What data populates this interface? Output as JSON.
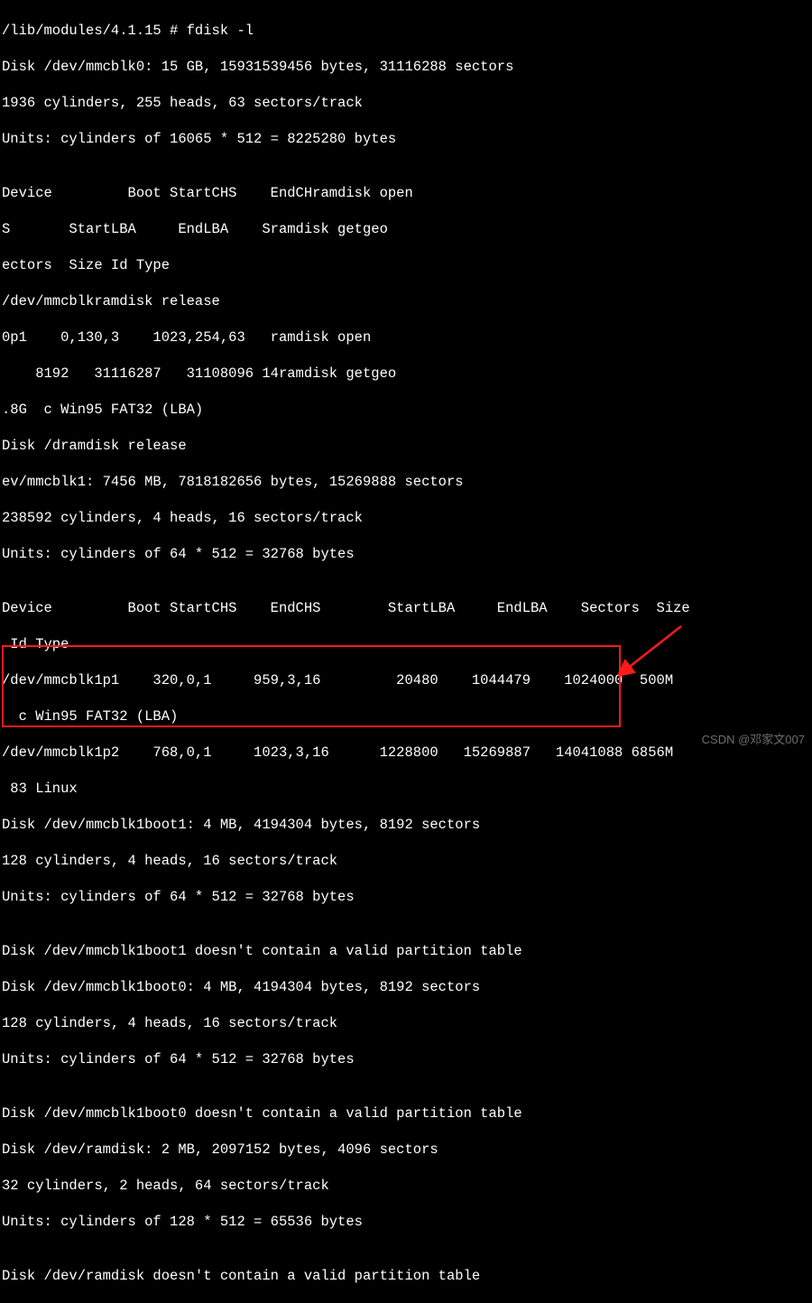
{
  "lines": [
    "/lib/modules/4.1.15 # fdisk -l",
    "Disk /dev/mmcblk0: 15 GB, 15931539456 bytes, 31116288 sectors",
    "1936 cylinders, 255 heads, 63 sectors/track",
    "Units: cylinders of 16065 * 512 = 8225280 bytes",
    "",
    "Device         Boot StartCHS    EndCHramdisk open",
    "S       StartLBA     EndLBA    Sramdisk getgeo",
    "ectors  Size Id Type",
    "/dev/mmcblkramdisk release",
    "0p1    0,130,3    1023,254,63   ramdisk open",
    "    8192   31116287   31108096 14ramdisk getgeo",
    ".8G  c Win95 FAT32 (LBA)",
    "Disk /dramdisk release",
    "ev/mmcblk1: 7456 MB, 7818182656 bytes, 15269888 sectors",
    "238592 cylinders, 4 heads, 16 sectors/track",
    "Units: cylinders of 64 * 512 = 32768 bytes",
    "",
    "Device         Boot StartCHS    EndCHS        StartLBA     EndLBA    Sectors  Size",
    " Id Type",
    "/dev/mmcblk1p1    320,0,1     959,3,16         20480    1044479    1024000  500M",
    "  c Win95 FAT32 (LBA)",
    "/dev/mmcblk1p2    768,0,1     1023,3,16      1228800   15269887   14041088 6856M",
    " 83 Linux",
    "Disk /dev/mmcblk1boot1: 4 MB, 4194304 bytes, 8192 sectors",
    "128 cylinders, 4 heads, 16 sectors/track",
    "Units: cylinders of 64 * 512 = 32768 bytes",
    "",
    "Disk /dev/mmcblk1boot1 doesn't contain a valid partition table",
    "Disk /dev/mmcblk1boot0: 4 MB, 4194304 bytes, 8192 sectors",
    "128 cylinders, 4 heads, 16 sectors/track",
    "Units: cylinders of 64 * 512 = 32768 bytes",
    "",
    "Disk /dev/mmcblk1boot0 doesn't contain a valid partition table",
    "Disk /dev/ramdisk: 2 MB, 2097152 bytes, 4096 sectors",
    "32 cylinders, 2 heads, 64 sectors/track",
    "Units: cylinders of 128 * 512 = 65536 bytes",
    "",
    "Disk /dev/ramdisk doesn't contain a valid partition table"
  ],
  "watermark": "CSDN @邓家文007"
}
